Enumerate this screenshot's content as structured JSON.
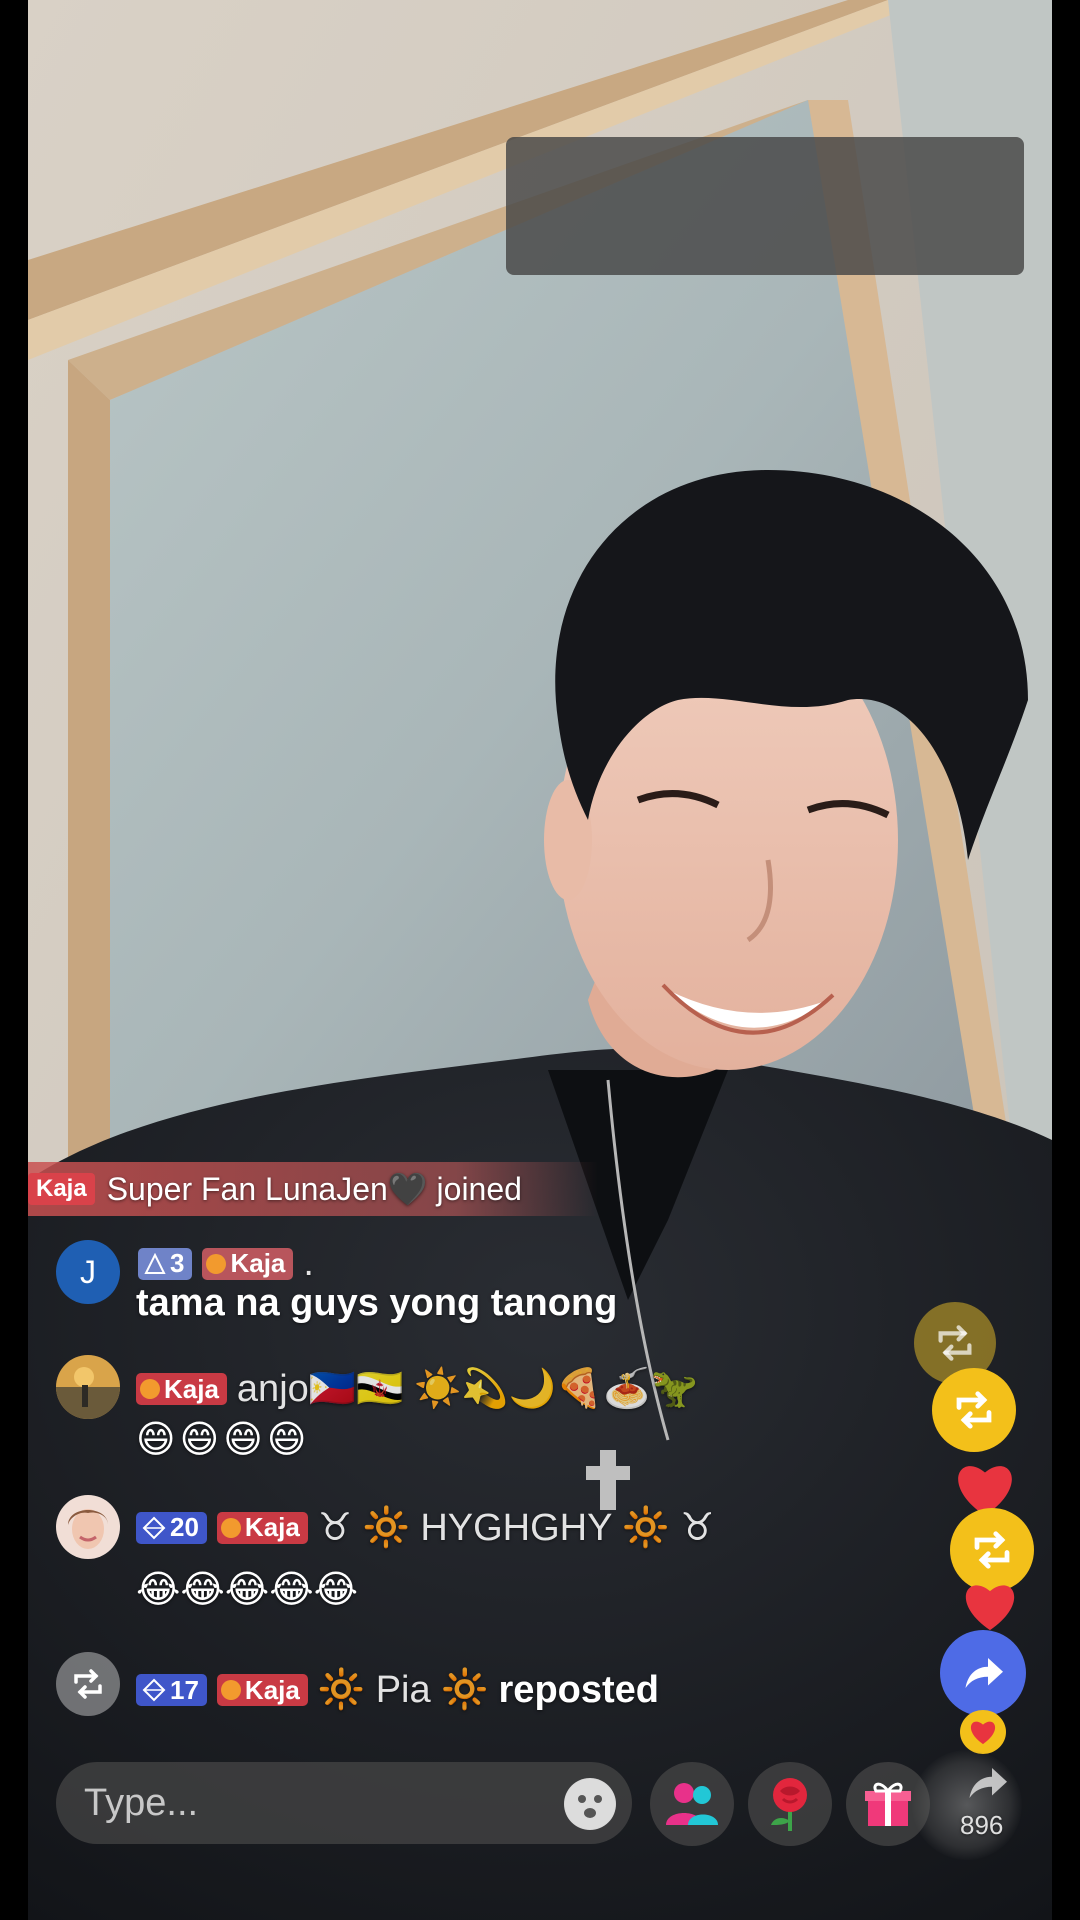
{
  "join_banner": {
    "rank_label": "Kaja",
    "text": "Super Fan LunaJen🖤 joined"
  },
  "comments": [
    {
      "avatar_letter": "J",
      "level": "3",
      "fan_label": "Kaja",
      "username": ".",
      "message": "tama na guys yong tanong"
    },
    {
      "fan_label": "Kaja",
      "username": "anjo🇵🇭🇧🇳 ☀️💫🌙🍕🍝🦖",
      "message": "😄😄😄😄"
    },
    {
      "level": "20",
      "fan_label": "Kaja",
      "username": "♉ 🔆 HYGHGHY 🔆 ♉",
      "message": "😂😂😂😂😂"
    },
    {
      "level": "17",
      "fan_label": "Kaja",
      "username": "🔆 Pia 🔆",
      "action": "reposted"
    }
  ],
  "input": {
    "placeholder": "Type..."
  },
  "like_count": "896",
  "icons": {
    "emoji": "smiley-icon",
    "multi_guest": "people-icon",
    "rose": "rose-icon",
    "gift": "gift-icon",
    "share": "share-arrow-icon",
    "repost": "repost-icon",
    "heart": "heart-icon"
  },
  "colors": {
    "fan_badge": "#c93a44",
    "level_badge_blue": "#3f56c9",
    "repost_yellow": "#f3c01a",
    "share_blue": "#4e6be6",
    "heart_red": "#e8343f"
  }
}
